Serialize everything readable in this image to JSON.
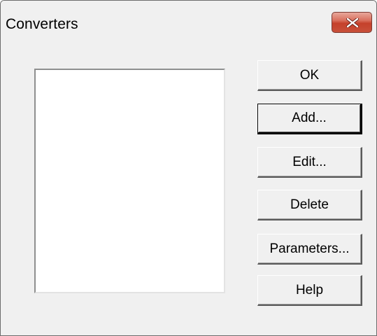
{
  "window": {
    "title": "Converters"
  },
  "colors": {
    "dialog_background": "#f0f0f0",
    "close_button": "#c5412b",
    "listbox_background": "#ffffff"
  },
  "close_button": {
    "icon": "close-icon"
  },
  "converters_list": {
    "items": []
  },
  "buttons": {
    "ok": "OK",
    "add": "Add...",
    "edit": "Edit...",
    "delete": "Delete",
    "parameters": "Parameters...",
    "help": "Help"
  }
}
